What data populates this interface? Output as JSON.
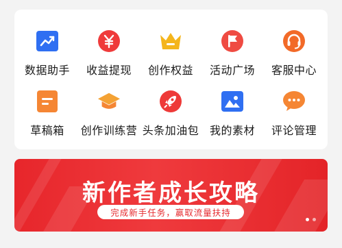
{
  "grid": {
    "items": [
      {
        "label": "数据助手",
        "icon": "data-chart-icon",
        "color": "#2f6ff2"
      },
      {
        "label": "收益提现",
        "icon": "yen-coin-icon",
        "color": "#ef3b3b"
      },
      {
        "label": "创作权益",
        "icon": "crown-icon",
        "color": "#f4b51c"
      },
      {
        "label": "活动广场",
        "icon": "flag-icon",
        "color": "#ef4b42"
      },
      {
        "label": "客服中心",
        "icon": "headset-icon",
        "color": "#f26a28"
      },
      {
        "label": "草稿箱",
        "icon": "draft-icon",
        "color": "#f58634"
      },
      {
        "label": "创作训练营",
        "icon": "graduation-cap-icon",
        "color": "#f4a234"
      },
      {
        "label": "头条加油包",
        "icon": "rocket-icon",
        "color": "#ee3a38"
      },
      {
        "label": "我的素材",
        "icon": "image-icon",
        "color": "#2f6ff2"
      },
      {
        "label": "评论管理",
        "icon": "comment-icon",
        "color": "#f58634"
      }
    ]
  },
  "banner": {
    "title": "新作者成长攻略",
    "subtitle": "完成新手任务，赢取流量扶持",
    "color": "#e7262b",
    "pages": 2,
    "active_page": 1
  }
}
